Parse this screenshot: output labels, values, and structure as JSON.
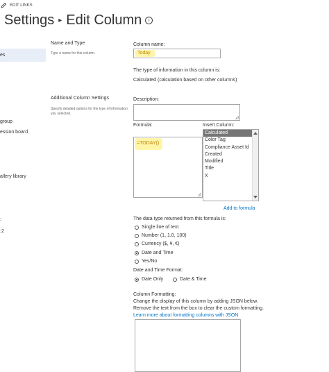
{
  "header": {
    "edit_links": "EDIT LINKS",
    "title_parent": "Settings",
    "title_current": "Edit Column",
    "info_icon": "i"
  },
  "left_nav": {
    "items": [
      {
        "label": "es",
        "selected": true
      },
      {
        "label": "group",
        "selected": false
      },
      {
        "label": "ession board",
        "selected": false
      },
      {
        "label": "allery library",
        "selected": false
      },
      {
        "label": ":",
        "selected": false
      },
      {
        "label": ":2",
        "selected": false
      }
    ]
  },
  "sections": {
    "name_type": {
      "title": "Name and Type",
      "description": "Type a name for this column."
    },
    "additional": {
      "title": "Additional Column Settings",
      "description": "Specify detailed options for the type of information you selected."
    }
  },
  "form": {
    "column_name_label": "Column name:",
    "column_name_value": "Today",
    "type_label": "The type of information in this column is:",
    "type_value": "Calculated (calculation based on other columns)",
    "description_label": "Description:",
    "formula_label": "Formula:",
    "formula_value": "=TODAY()",
    "insert_column_label": "Insert Column:",
    "insert_column_options": [
      "Calculated",
      "Color Tag",
      "Compliance Asset Id",
      "Created",
      "Modified",
      "Title",
      "X"
    ],
    "insert_column_selected": "Calculated",
    "add_to_formula": "Add to formula",
    "return_type_label": "The data type returned from this formula is:",
    "return_types": [
      {
        "label": "Single line of text",
        "checked": false
      },
      {
        "label": "Number (1, 1.0, 100)",
        "checked": false
      },
      {
        "label": "Currency ($, ¥, €)",
        "checked": false
      },
      {
        "label": "Date and Time",
        "checked": true
      },
      {
        "label": "Yes/No",
        "checked": false
      }
    ],
    "datetime_format_label": "Date and Time Format:",
    "datetime_formats": [
      {
        "label": "Date Only",
        "checked": true
      },
      {
        "label": "Date & Time",
        "checked": false
      }
    ],
    "formatting_title": "Column Formatting:",
    "formatting_desc1": "Change the display of this column by adding JSON below.",
    "formatting_desc2": "Remove the text from the box to clear the custom formatting.",
    "formatting_link": "Learn more about formatting columns with JSON"
  },
  "colors": {
    "accent_link": "#0072c6",
    "highlight": "#fff5a8",
    "selected_option": "#767676"
  }
}
